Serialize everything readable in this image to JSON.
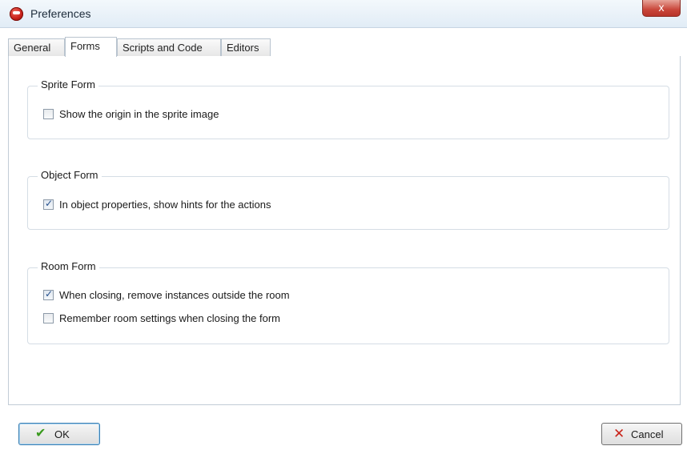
{
  "window": {
    "title": "Preferences",
    "close_symbol": "x",
    "app_icon": "game-maker-icon"
  },
  "tabs": [
    {
      "label": "General",
      "active": false
    },
    {
      "label": "Forms",
      "active": true
    },
    {
      "label": "Scripts and Code",
      "active": false
    },
    {
      "label": "Editors",
      "active": false
    }
  ],
  "groups": {
    "sprite_form": {
      "title": "Sprite Form",
      "options": [
        {
          "label": "Show the origin in the sprite image",
          "checked": false
        }
      ]
    },
    "object_form": {
      "title": "Object Form",
      "options": [
        {
          "label": "In object properties, show hints for the actions",
          "checked": true
        }
      ]
    },
    "room_form": {
      "title": "Room Form",
      "options": [
        {
          "label": "When closing, remove instances outside the room",
          "checked": true
        },
        {
          "label": "Remember room settings when closing the form",
          "checked": false
        }
      ]
    }
  },
  "buttons": {
    "ok": {
      "label": "OK",
      "icon": "check-icon",
      "icon_color": "#3a9a1e"
    },
    "cancel": {
      "label": "Cancel",
      "icon": "x-icon",
      "icon_color": "#c9251b"
    }
  },
  "check_glyph": "✓"
}
